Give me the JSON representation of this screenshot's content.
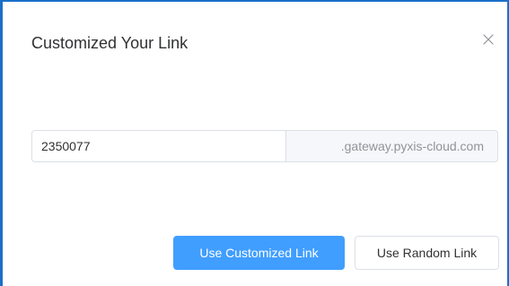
{
  "dialog": {
    "title": "Customized Your Link",
    "close_icon": "close-icon",
    "link": {
      "value": "2350077",
      "placeholder": "",
      "suffix": ".gateway.pyxis-cloud.com"
    },
    "buttons": {
      "customized_label": "Use Customized Link",
      "random_label": "Use Random Link"
    }
  },
  "colors": {
    "primary": "#409eff",
    "window_edge": "#1a6fc9",
    "suffix_background": "#f5f7fa",
    "border": "#dcdfe6",
    "title_text": "#303133",
    "muted_text": "#909399"
  }
}
